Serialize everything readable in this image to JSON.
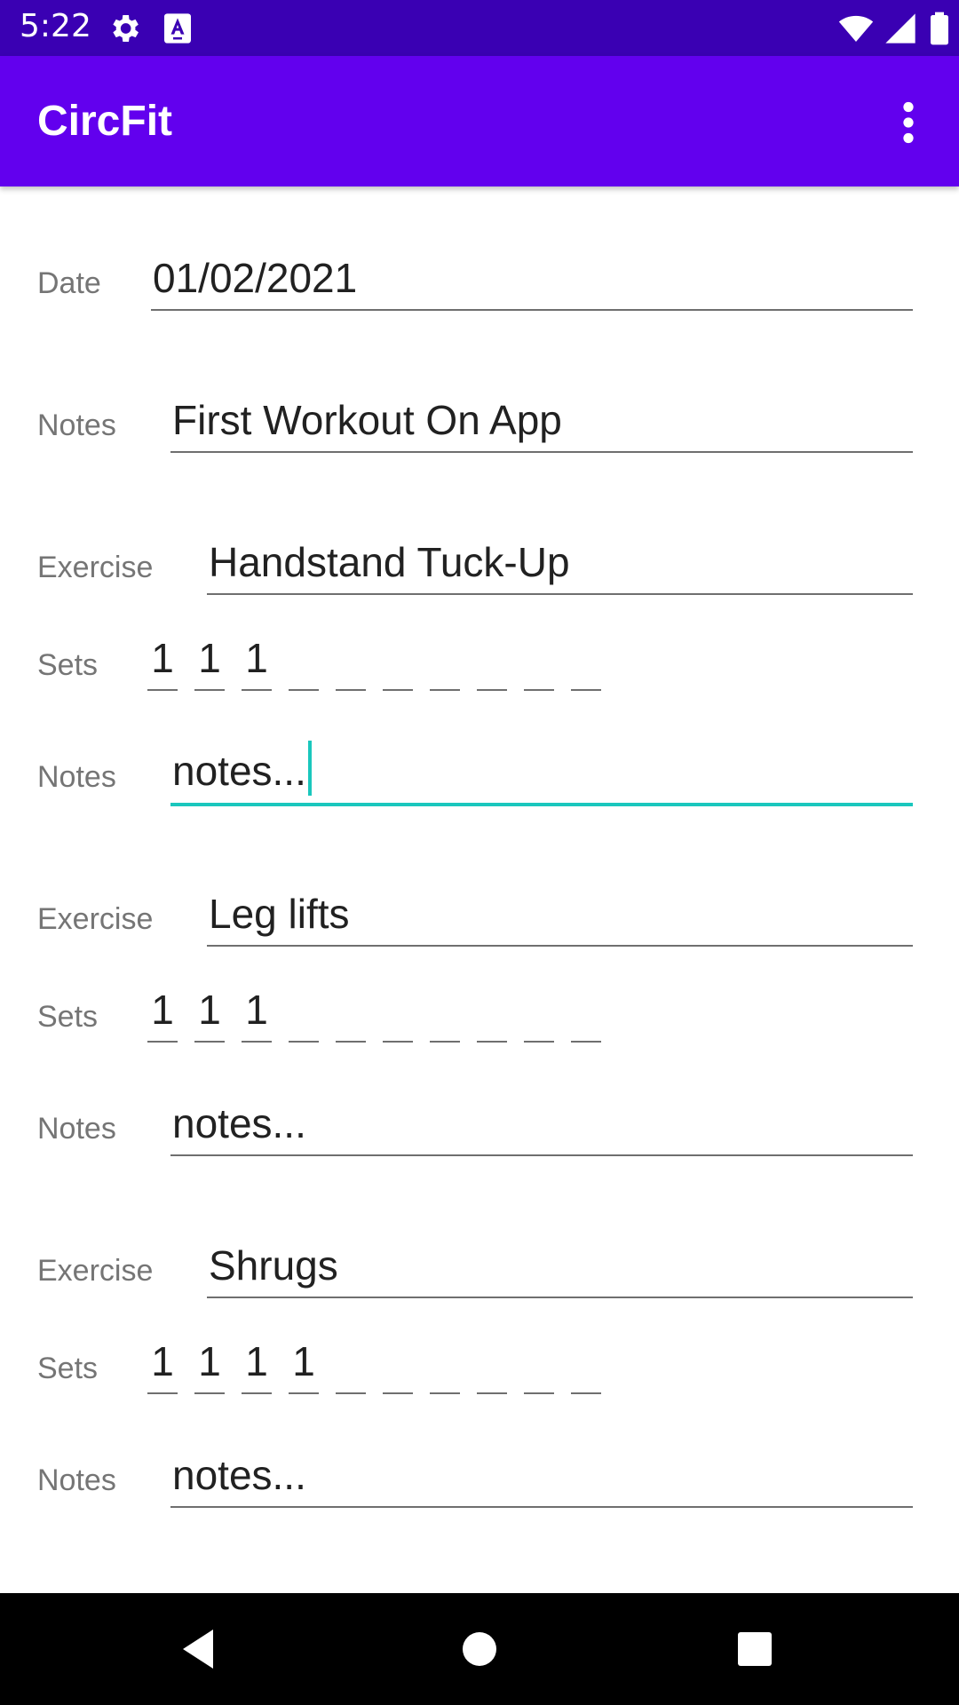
{
  "status_bar": {
    "time": "5:22"
  },
  "app_bar": {
    "title": "CircFit"
  },
  "workout": {
    "date_label": "Date",
    "date_value": "01/02/2021",
    "notes_label": "Notes",
    "notes_value": "First Workout On App"
  },
  "exercises": [
    {
      "exercise_label": "Exercise",
      "name": "Handstand Tuck-Up",
      "sets_label": "Sets",
      "sets": [
        "1",
        "1",
        "1",
        "",
        "",
        "",
        "",
        "",
        "",
        ""
      ],
      "notes_label": "Notes",
      "notes": "notes...",
      "focused": true
    },
    {
      "exercise_label": "Exercise",
      "name": "Leg lifts",
      "sets_label": "Sets",
      "sets": [
        "1",
        "1",
        "1",
        "",
        "",
        "",
        "",
        "",
        "",
        ""
      ],
      "notes_label": "Notes",
      "notes": "notes...",
      "focused": false
    },
    {
      "exercise_label": "Exercise",
      "name": "Shrugs",
      "sets_label": "Sets",
      "sets": [
        "1",
        "1",
        "1",
        "1",
        "",
        "",
        "",
        "",
        "",
        ""
      ],
      "notes_label": "Notes",
      "notes": "notes...",
      "focused": false
    }
  ],
  "colors": {
    "status_bar": "#3a00b3",
    "app_bar": "#6200ee",
    "focus_accent": "#1ac7bd"
  },
  "icons": [
    "gear-icon",
    "text-a-icon",
    "wifi-icon",
    "signal-icon",
    "battery-icon",
    "overflow-menu-icon",
    "back-icon",
    "home-icon",
    "recents-icon"
  ]
}
